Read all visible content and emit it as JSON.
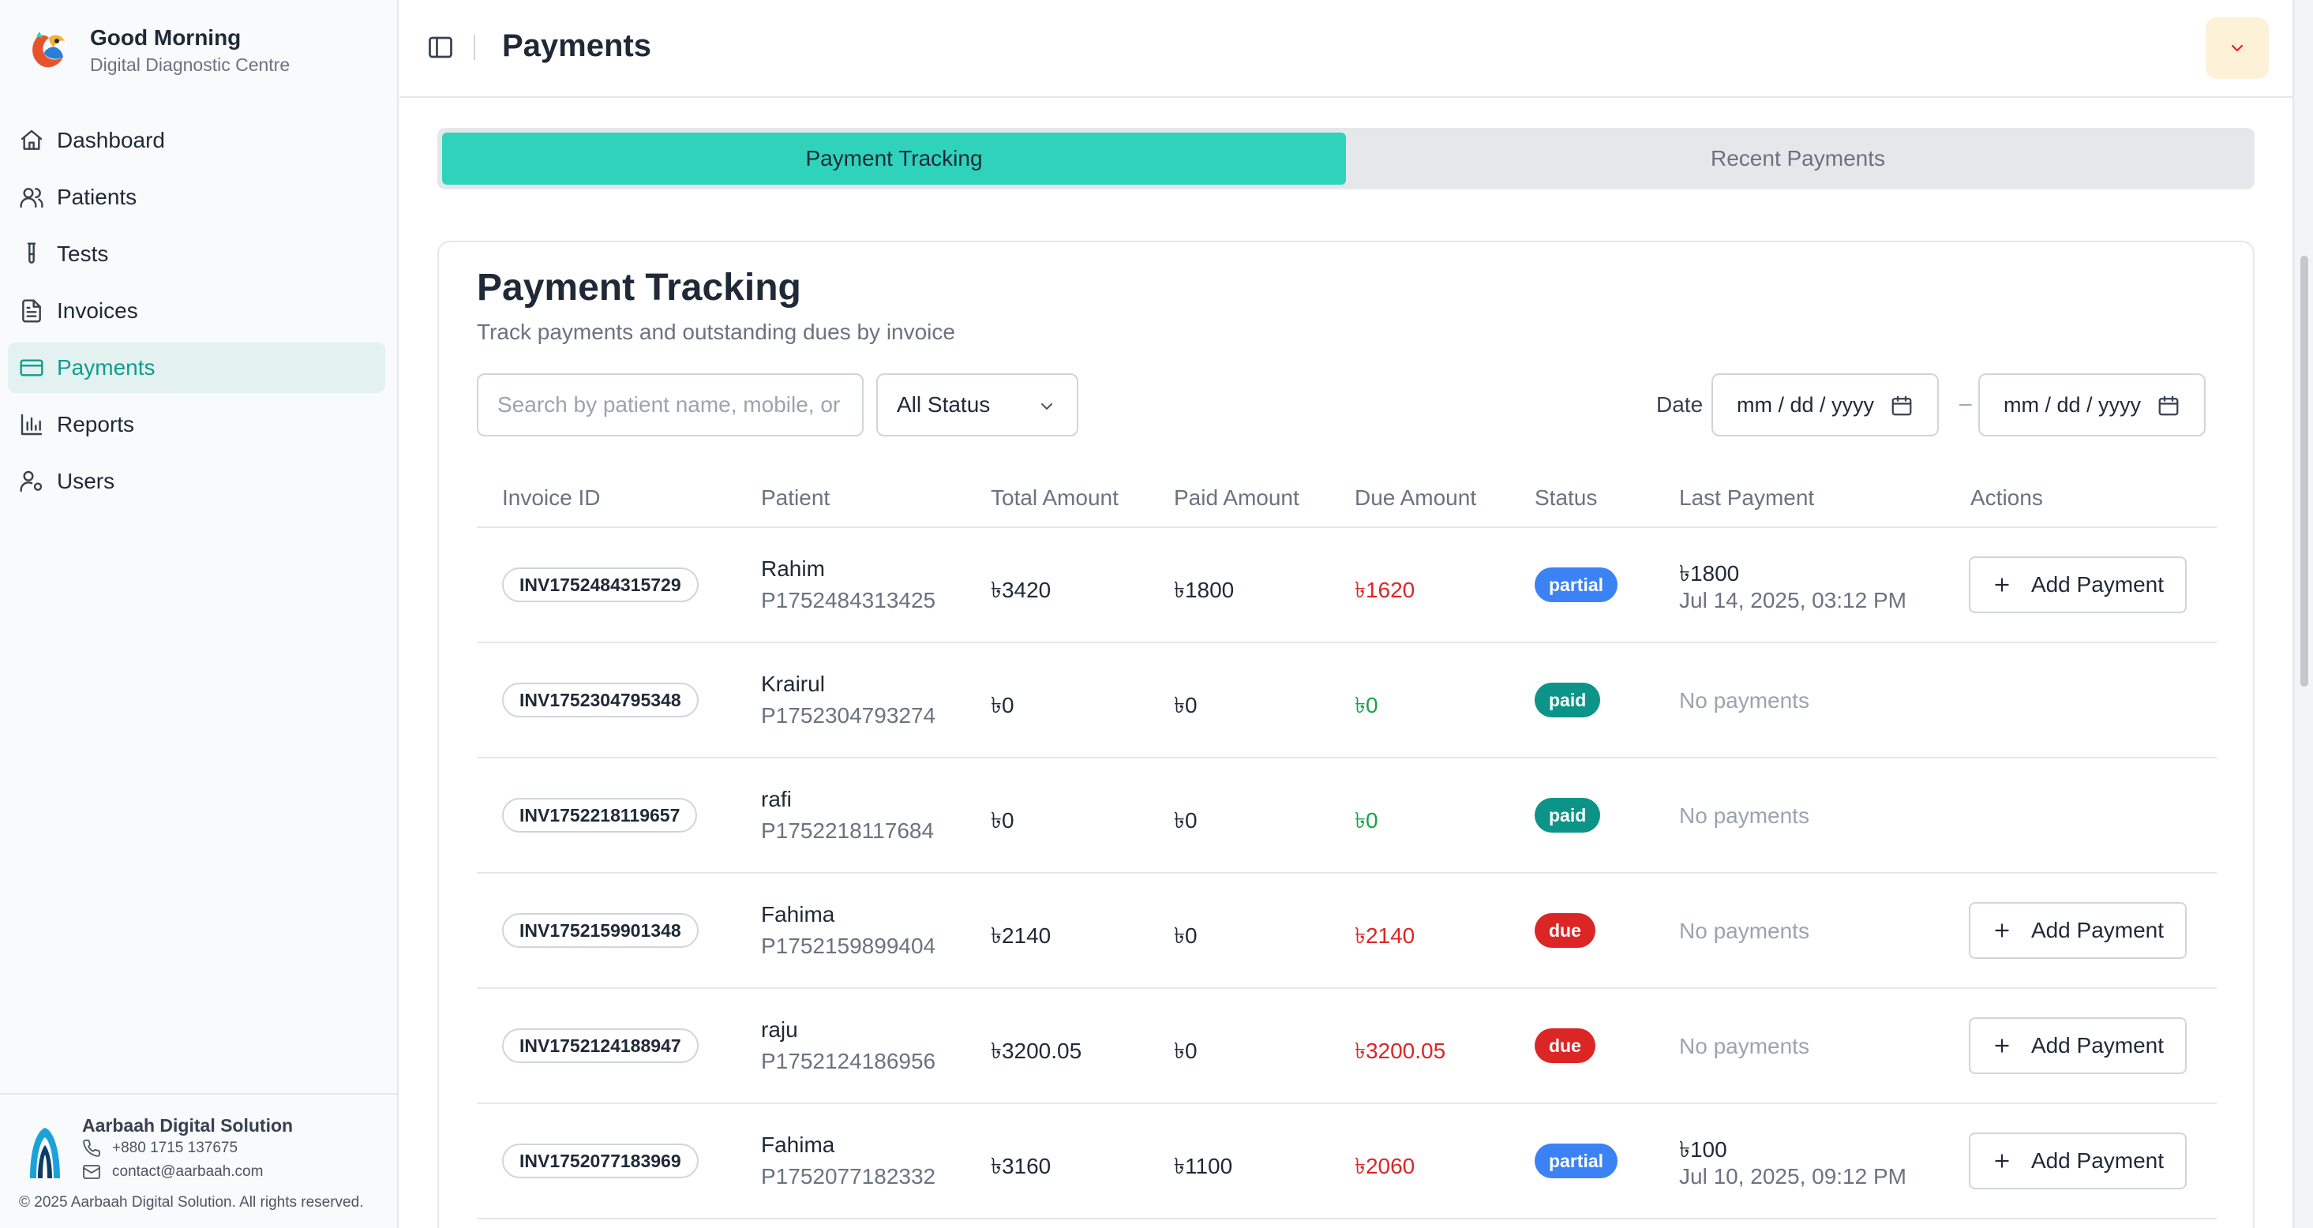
{
  "brand": {
    "title": "Good Morning",
    "subtitle": "Digital Diagnostic Centre"
  },
  "nav": [
    {
      "label": "Dashboard",
      "icon": "home-icon"
    },
    {
      "label": "Patients",
      "icon": "users-icon"
    },
    {
      "label": "Tests",
      "icon": "test-tube-icon"
    },
    {
      "label": "Invoices",
      "icon": "file-text-icon"
    },
    {
      "label": "Payments",
      "icon": "credit-card-icon",
      "active": true
    },
    {
      "label": "Reports",
      "icon": "bar-chart-icon"
    },
    {
      "label": "Users",
      "icon": "user-cog-icon"
    }
  ],
  "footer": {
    "company": "Aarbaah Digital Solution",
    "phone": "+880 1715 137675",
    "email": "contact@aarbaah.com",
    "copyright": "© 2025 Aarbaah Digital Solution. All rights reserved."
  },
  "header": {
    "title": "Payments"
  },
  "tabs": [
    {
      "label": "Payment Tracking",
      "active": true
    },
    {
      "label": "Recent Payments",
      "active": false
    }
  ],
  "card": {
    "title": "Payment Tracking",
    "subtitle": "Track payments and outstanding dues by invoice"
  },
  "filters": {
    "search_placeholder": "Search by patient name, mobile, or",
    "status_value": "All Status",
    "date_label": "Date",
    "date_from": "mm / dd / yyyy",
    "date_sep": "–",
    "date_to": "mm / dd / yyyy"
  },
  "table": {
    "headers": [
      "Invoice ID",
      "Patient",
      "Total Amount",
      "Paid Amount",
      "Due Amount",
      "Status",
      "Last Payment",
      "Actions"
    ],
    "add_payment_label": "Add Payment",
    "rows": [
      {
        "invoice": "INV1752484315729",
        "name": "Rahim",
        "pid": "P1752484313425",
        "total": "৳3420",
        "paid": "৳1800",
        "due": "৳1620",
        "status": "partial",
        "last_amount": "৳1800",
        "last_date": "Jul 14, 2025, 03:12 PM"
      },
      {
        "invoice": "INV1752304795348",
        "name": "Krairul",
        "pid": "P1752304793274",
        "total": "৳0",
        "paid": "৳0",
        "due": "৳0",
        "status": "paid",
        "last_none": "No payments"
      },
      {
        "invoice": "INV1752218119657",
        "name": "rafi",
        "pid": "P1752218117684",
        "total": "৳0",
        "paid": "৳0",
        "due": "৳0",
        "status": "paid",
        "last_none": "No payments"
      },
      {
        "invoice": "INV1752159901348",
        "name": "Fahima",
        "pid": "P1752159899404",
        "total": "৳2140",
        "paid": "৳0",
        "due": "৳2140",
        "status": "due",
        "last_none": "No payments"
      },
      {
        "invoice": "INV1752124188947",
        "name": "raju",
        "pid": "P1752124186956",
        "total": "৳3200.05",
        "paid": "৳0",
        "due": "৳3200.05",
        "status": "due",
        "last_none": "No payments"
      },
      {
        "invoice": "INV1752077183969",
        "name": "Fahima",
        "pid": "P1752077182332",
        "total": "৳3160",
        "paid": "৳1100",
        "due": "৳2060",
        "status": "partial",
        "last_amount": "৳100",
        "last_date": "Jul 10, 2025, 09:12 PM"
      }
    ]
  },
  "colors": {
    "accent": "#2fd3bc",
    "active_nav": "#0f9c8e",
    "due": "#dc2626",
    "paid": "#16a34a",
    "partial_badge": "#3b82f6"
  }
}
